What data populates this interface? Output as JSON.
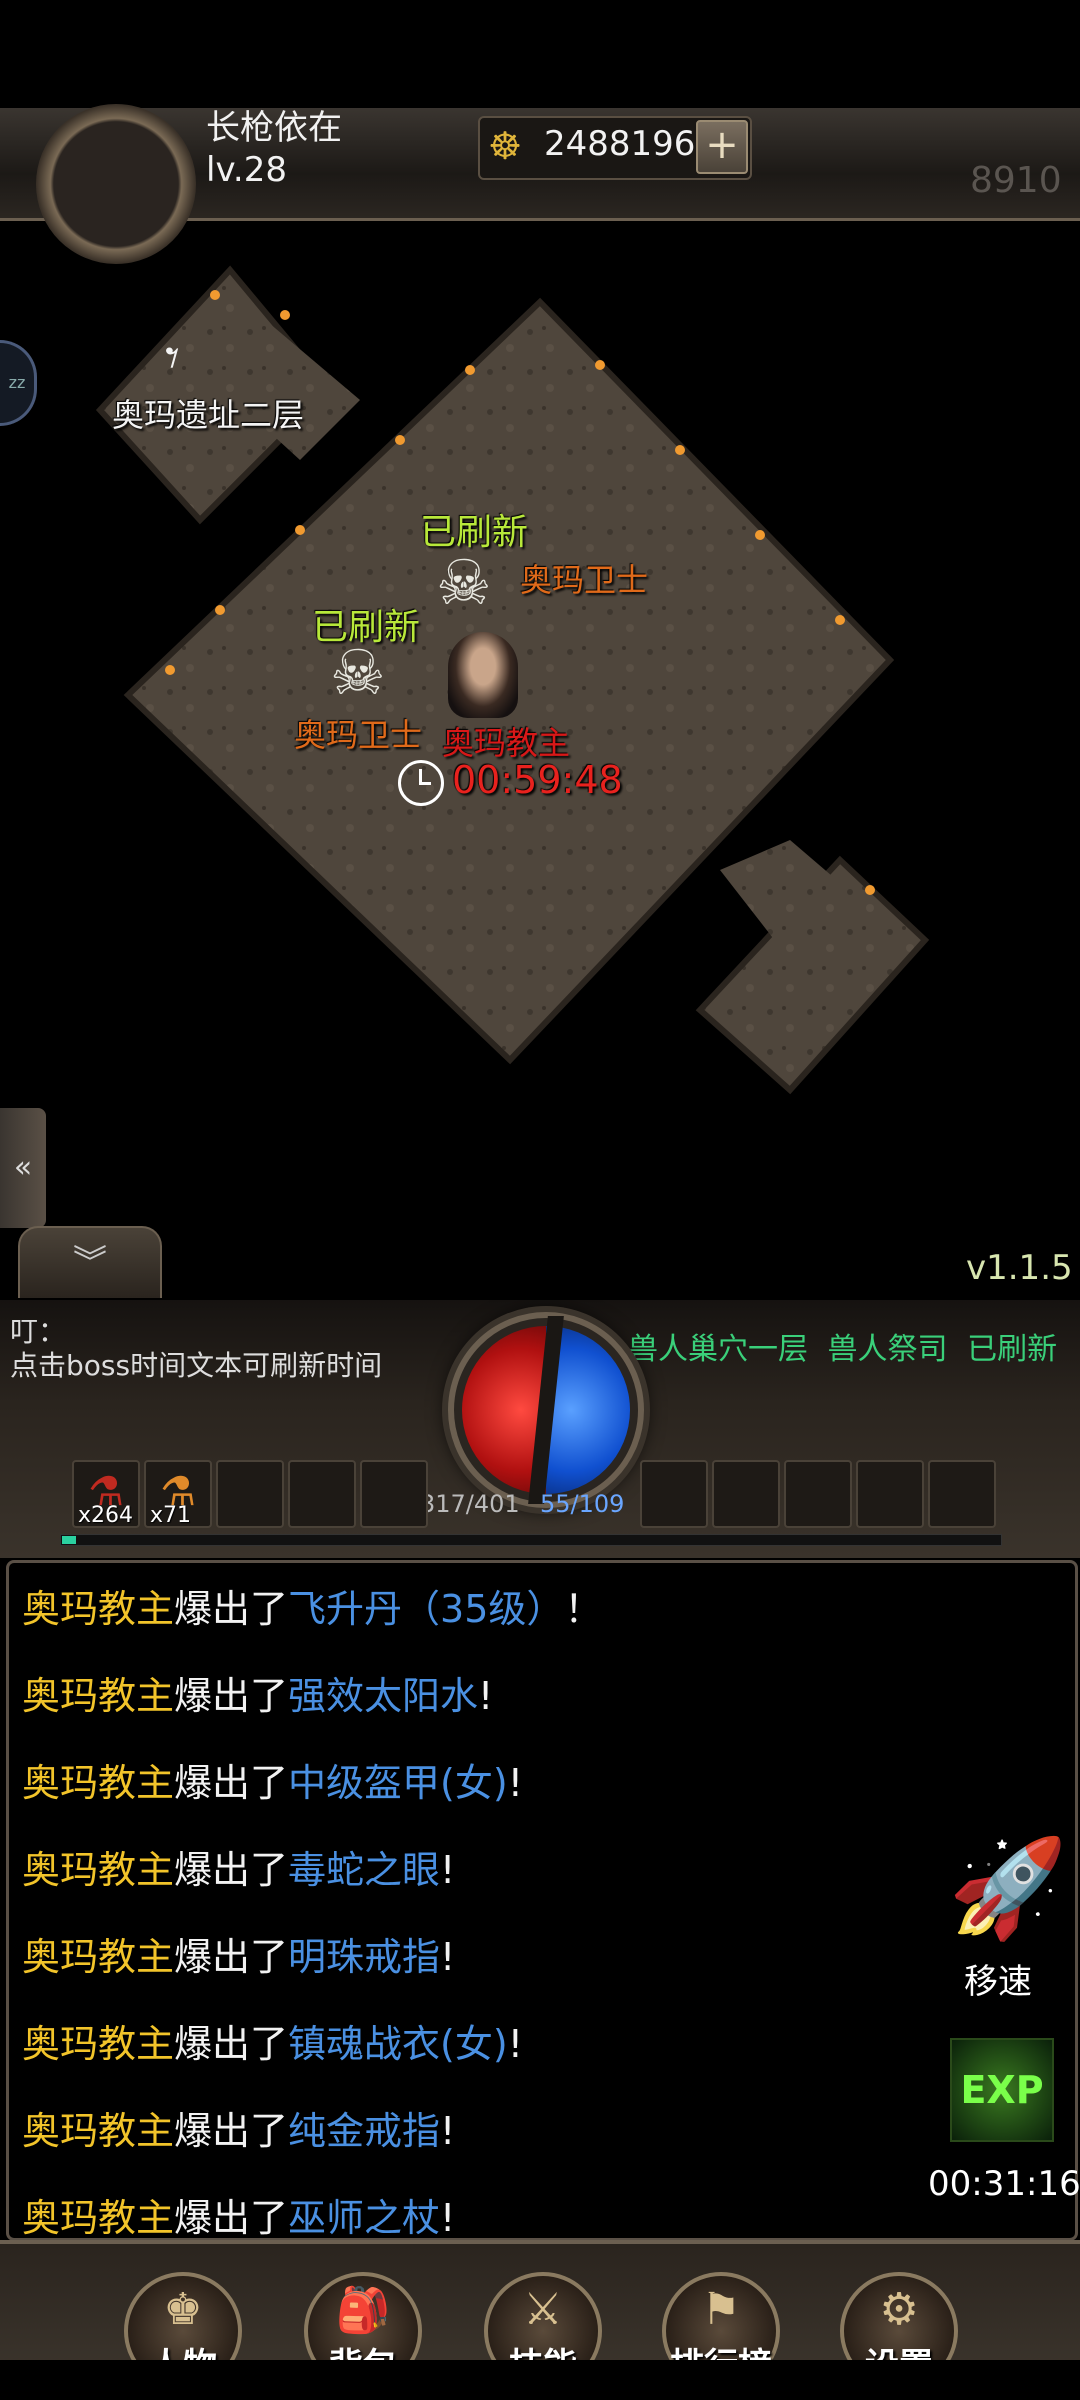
{
  "header": {
    "player_name": "长枪依在",
    "player_level": "lv.28",
    "gold_icon": "gold-ingot-icon",
    "gold": "2488196",
    "gold_add": "+",
    "power": "8910"
  },
  "map": {
    "exit_label": "奥玛遗址二层",
    "markers": [
      {
        "status": "已刷新",
        "name": "奥玛卫士"
      },
      {
        "status": "已刷新",
        "name": "奥玛卫士"
      }
    ],
    "boss_name": "奥玛教主",
    "boss_timer": "00:59:48"
  },
  "controls": {
    "collapse_side": "«",
    "collapse_down": "︾",
    "version": "v1.1.5"
  },
  "hud": {
    "notice_title": "叮：",
    "notice_text": "点击boss时间文本可刷新时间",
    "boss_status": {
      "map": "兽人巢穴一层",
      "boss": "兽人祭司",
      "status": "已刷新"
    },
    "hp": "317/401",
    "mp": "55/109",
    "hp_fraction": 0.79,
    "mp_fraction": 0.5,
    "xp_fraction": 0.015,
    "slots": [
      {
        "icon": "red-potion-icon",
        "count": "x264"
      },
      {
        "icon": "orange-potion-icon",
        "count": "x71"
      }
    ]
  },
  "chat": {
    "verb": "爆出了",
    "lines": [
      {
        "boss": "奥玛教主",
        "item": "飞升丹（35级）",
        "end": "！"
      },
      {
        "boss": "奥玛教主",
        "item": "强效太阳水",
        "end": "!"
      },
      {
        "boss": "奥玛教主",
        "item": "中级盔甲(女)",
        "end": "!"
      },
      {
        "boss": "奥玛教主",
        "item": "毒蛇之眼",
        "end": "!"
      },
      {
        "boss": "奥玛教主",
        "item": "明珠戒指",
        "end": "!"
      },
      {
        "boss": "奥玛教主",
        "item": "镇魂战衣(女)",
        "end": "!"
      },
      {
        "boss": "奥玛教主",
        "item": "纯金戒指",
        "end": "!"
      },
      {
        "boss": "奥玛教主",
        "item": "巫师之杖",
        "end": "!"
      }
    ]
  },
  "side_buttons": {
    "speed_label": "移速",
    "speed_icon": "rocket-icon",
    "exp_label": "EXP",
    "exp_timer": "00:31:16"
  },
  "bottom_nav": [
    {
      "label": "人物",
      "icon": "character-icon"
    },
    {
      "label": "背包",
      "icon": "backpack-icon"
    },
    {
      "label": "技能",
      "icon": "crossed-swords-icon"
    },
    {
      "label": "排行榜",
      "icon": "ranking-icon"
    },
    {
      "label": "设置",
      "icon": "gear-icon"
    }
  ],
  "colors": {
    "refreshed": "#b8e83a",
    "guard_name": "#e06a1a",
    "boss_name": "#d81818",
    "chat_boss": "#f2c42a",
    "chat_item": "#4a90e2"
  }
}
